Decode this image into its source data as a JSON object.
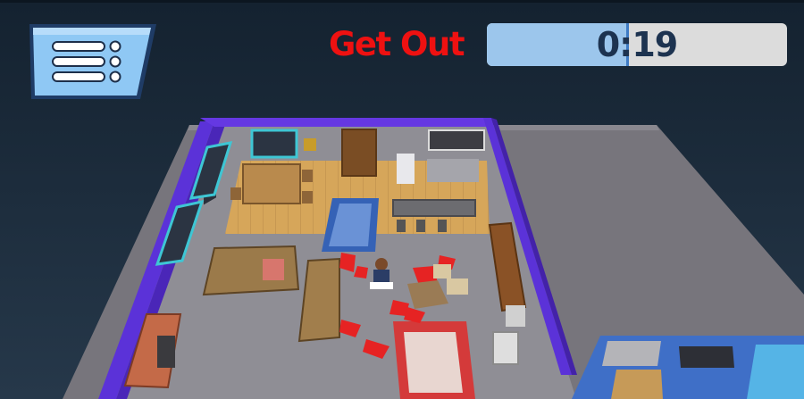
{
  "hud": {
    "menu_button": {
      "icon": "menu-list-icon"
    },
    "objective_text": "Get Out",
    "timer": {
      "text": "0:19",
      "fill_percent": 46.5
    }
  },
  "colors": {
    "objective": "#ee1111",
    "timer_track": "#dcdcdc",
    "timer_fill": "#9cc6ec",
    "menu_button": "#8fc8f4",
    "walls": "#5b32d8",
    "floor": "#8e8e96",
    "wood_floor": "#d9a95b",
    "background": "#1e2e3e"
  }
}
